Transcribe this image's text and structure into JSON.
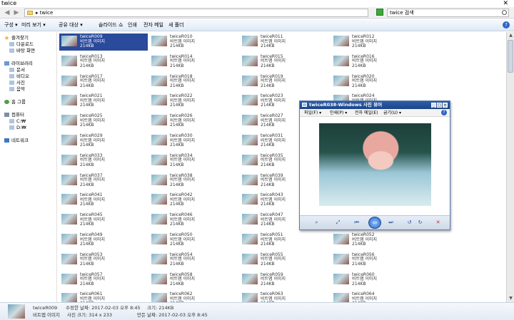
{
  "window": {
    "title": "twice"
  },
  "address_bar": {
    "path": "▸ twice",
    "search_placeholder": "twice 검색"
  },
  "toolbar": {
    "items": [
      "구성 ▾",
      "미리 보기 ▾",
      "공유 대상 ▾",
      "슬라이드 쇼",
      "인쇄",
      "전자 메일",
      "새 폴더"
    ],
    "help": "?"
  },
  "sidebar": {
    "favorites": "즐겨찾기",
    "downloads": "다운로드",
    "desktop": "바탕 화면",
    "libraries": "라이브러리",
    "documents": "문서",
    "videos": "비디오",
    "pictures": "사진",
    "music": "음악",
    "homegroup": "홈 그룹",
    "computer": "컴퓨터",
    "drive_c": "C:₩",
    "drive_d": "D:₩",
    "network": "네트워크"
  },
  "files": {
    "type_label": "비트맵 이미지",
    "size_label": "214KB",
    "selected_index": 0,
    "names": [
      "twiceR009",
      "twiceR010",
      "twiceR011",
      "twiceR012",
      "twiceR013",
      "twiceR014",
      "twiceR015",
      "twiceR016",
      "twiceR017",
      "twiceR018",
      "twiceR019",
      "twiceR020",
      "twiceR021",
      "twiceR022",
      "twiceR023",
      "twiceR024",
      "twiceR025",
      "twiceR026",
      "twiceR027",
      "twiceR028",
      "twiceR029",
      "twiceR030",
      "twiceR031",
      "twiceR032",
      "twiceR033",
      "twiceR034",
      "twiceR035",
      "twiceR036",
      "twiceR037",
      "twiceR038",
      "twiceR039",
      "twiceR040",
      "twiceR041",
      "twiceR042",
      "twiceR043",
      "twiceR044",
      "twiceR045",
      "twiceR046",
      "twiceR047",
      "twiceR048",
      "twiceR049",
      "twiceR050",
      "twiceR051",
      "twiceR052",
      "twiceR053",
      "twiceR054",
      "twiceR055",
      "twiceR056",
      "twiceR057",
      "twiceR058",
      "twiceR059",
      "twiceR060",
      "twiceR061",
      "twiceR062",
      "twiceR063",
      "twiceR064"
    ]
  },
  "details": {
    "name": "twiceR009",
    "type": "비트맵 이미지",
    "modified": "수정한 날짜: 2017-02-03 오후 8:45",
    "dimensions": "사진 크기: 314 x 233",
    "size": "크기: 214KB",
    "created": "만든 날짜: 2017-02-03 오후 8:45"
  },
  "viewer": {
    "title": "twiceR038-Windows 사진 뷰어",
    "menu": [
      "파일(F) ▾",
      "인쇄(P) ▾",
      "전자 메일(E)",
      "굽기(U) ▾"
    ],
    "help": "?",
    "window_buttons": [
      "_",
      "□",
      "×"
    ]
  }
}
